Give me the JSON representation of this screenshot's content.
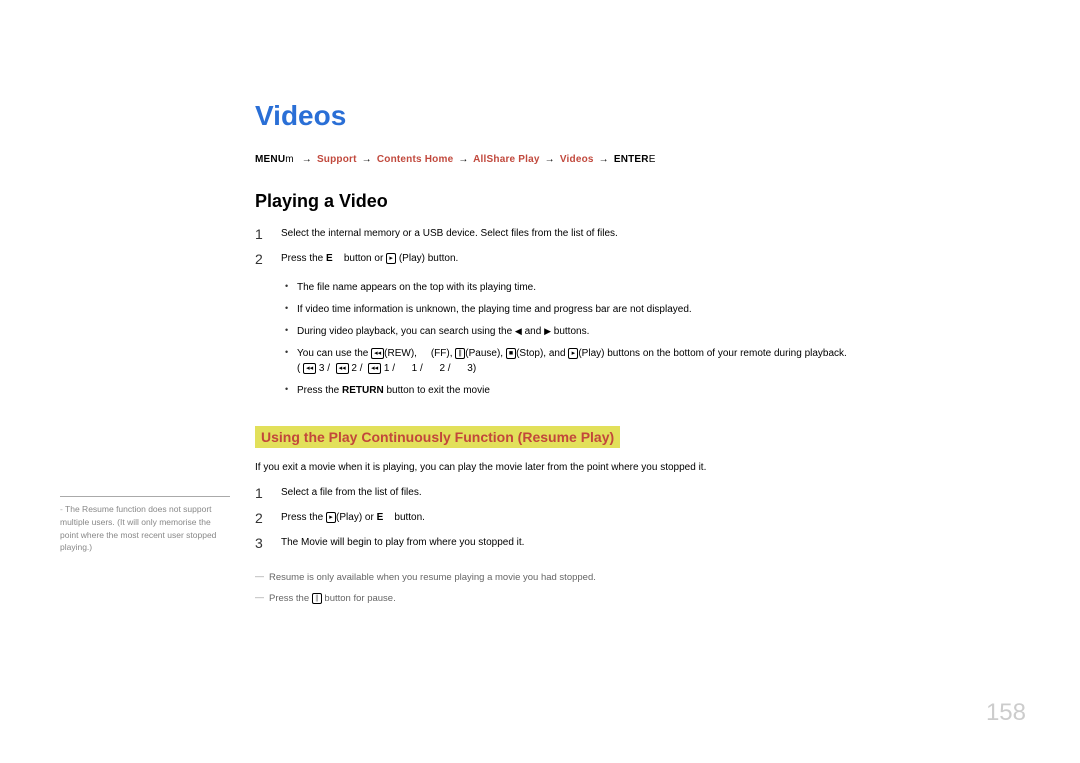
{
  "title": "Videos",
  "breadcrumb": {
    "prefix": "MENU",
    "prefix_suffix": "m",
    "items": [
      "Support",
      "Contents Home",
      "AllShare Play",
      "Videos"
    ],
    "suffix_label": "ENTER",
    "suffix_glyph": "E",
    "arrow": "→"
  },
  "section1": {
    "heading": "Playing a Video",
    "steps": [
      "Select the internal memory or a USB device. Select files from the list of files.",
      "Press the E     button or ∂ (Play) button."
    ],
    "bullets": [
      "The file name appears on the top with its playing time.",
      "If video time information is unknown, the playing time and progress bar are not displayed.",
      "During video playback, you can search using the ◄ and ► buttons.",
      "You can use the π(REW),      (FF), ∑(Pause), ∫(Stop), and ∂(Play) buttons on the bottom of your remote during playback. ( π 3 /  π 2 /  π 1 /       1 /       2 /       3)",
      "Press the RETURN button to exit the movie"
    ]
  },
  "section2": {
    "heading": "Using the Play Continuously Function (Resume Play)",
    "intro": "If you exit a movie when it is playing, you can play the movie later from the point where you stopped it.",
    "steps": [
      "Select a file from the list of files.",
      "Press the ∂(Play) or E     button.",
      "The Movie will begin to play from where you stopped it."
    ],
    "notes": [
      "Resume is only available when you resume playing a movie you had stopped.",
      "Press the ∑ button for pause."
    ]
  },
  "sidebar_note": "The Resume function does not support multiple users. (It will only memorise the point where the most recent user stopped playing.)",
  "page_number": "158",
  "icons": {
    "play": "▸",
    "pause": "∥",
    "stop": "■",
    "rew": "◂◂",
    "ff": "▸▸",
    "left": "◀",
    "right": "▶"
  }
}
